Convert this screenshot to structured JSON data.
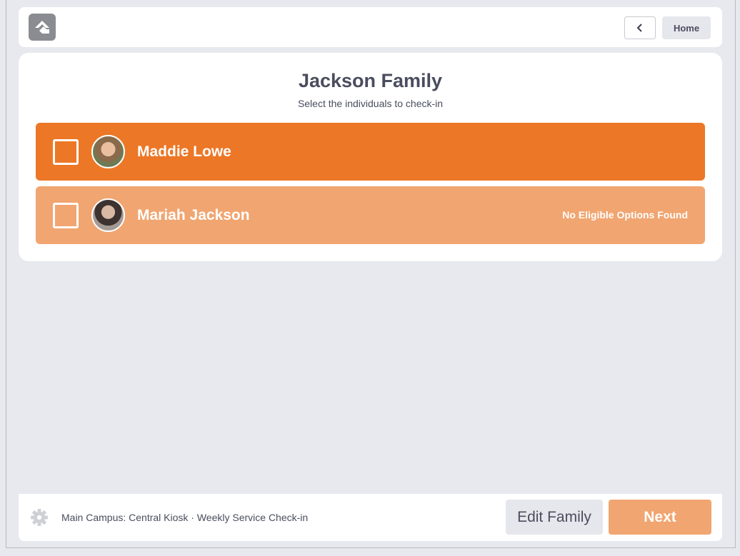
{
  "header": {
    "logo_icon": "rock-logo-icon",
    "back_icon": "chevron-left-icon",
    "home_label": "Home"
  },
  "family": {
    "title": "Jackson Family",
    "subtitle": "Select the individuals to check-in"
  },
  "people": [
    {
      "name": "Maddie Lowe",
      "note": "",
      "checked": false,
      "color": "#ec7726"
    },
    {
      "name": "Mariah Jackson",
      "note": "No Eligible Options Found",
      "checked": false,
      "color": "#f1a570"
    }
  ],
  "footer": {
    "settings_icon": "gear-icon",
    "kiosk_info": "Main Campus: Central Kiosk · Weekly Service Check-in",
    "edit_label": "Edit Family",
    "next_label": "Next"
  },
  "colors": {
    "accent": "#ec7726",
    "accent_light": "#f1a570",
    "background": "#e8e9ee",
    "text": "#4a4d5e"
  }
}
